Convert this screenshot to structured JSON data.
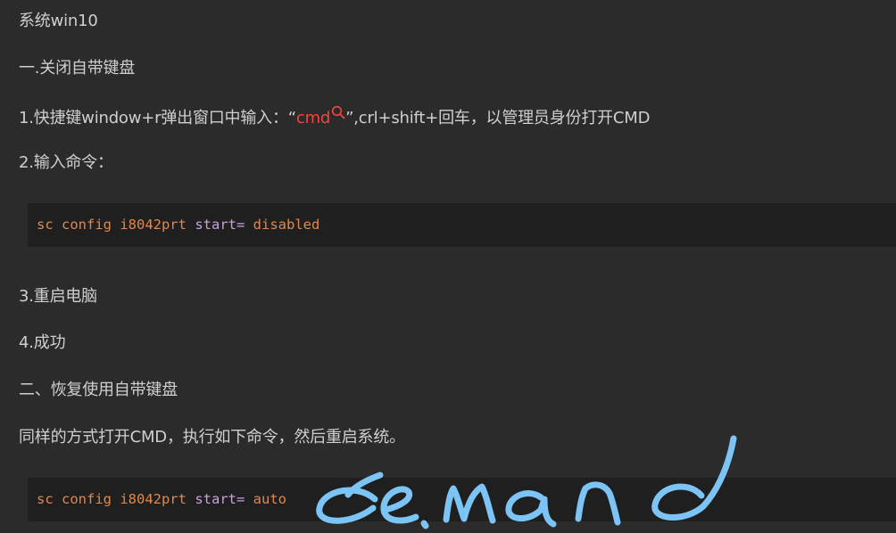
{
  "article": {
    "line1": "系统win10",
    "heading1": "一.关闭自带键盘",
    "step1": {
      "prefix": "1.快捷键window+r弹出窗口中输入：“",
      "keyword": "cmd",
      "suffix": "”,crl+shift+回车，以管理员身份打开CMD"
    },
    "step2": "2.输入命令：",
    "code1": {
      "cmd": "sc config i8042prt",
      "param": "start=",
      "value": "disabled"
    },
    "step3": "3.重启电脑",
    "step4": "4.成功",
    "heading2": "二、恢复使用自带键盘",
    "para2": "同样的方式打开CMD，执行如下命令，然后重启系统。",
    "code2": {
      "cmd": "sc config i8042prt",
      "param": "start=",
      "value": "auto"
    }
  },
  "annotation": {
    "handwritten_text": "demand",
    "color": "#7cc4f5"
  },
  "colors": {
    "background": "#2b2b2b",
    "text": "#cfcfcf",
    "link": "#f0473c",
    "code_background": "#1f1f1f",
    "code_command": "#e0884c",
    "code_param": "#c9a0dc"
  },
  "icons": {
    "keyword_search": "search-icon"
  }
}
